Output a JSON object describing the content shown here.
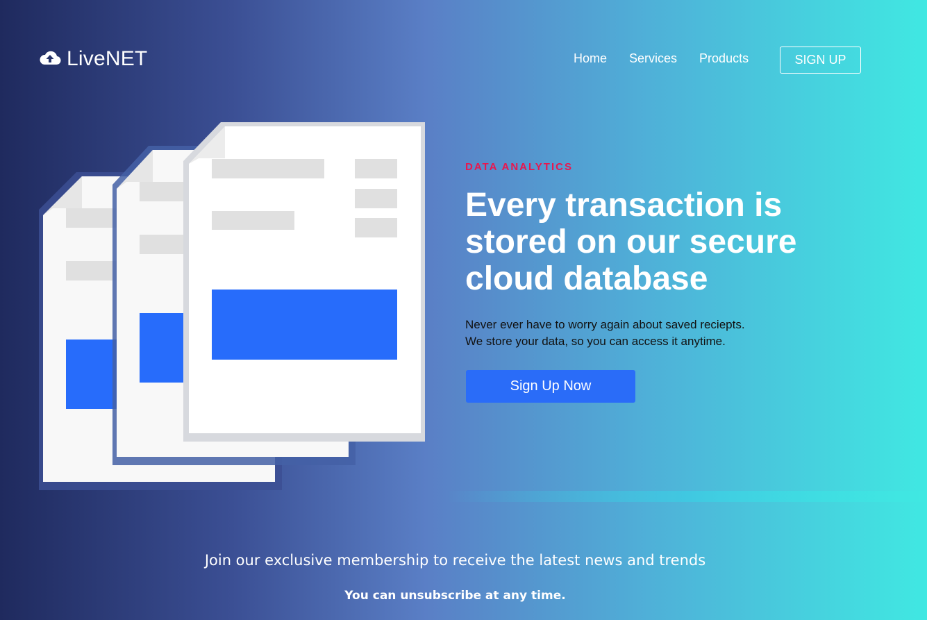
{
  "brand": {
    "name": "LiveNET",
    "icon": "cloud-upload-icon"
  },
  "nav": {
    "links": [
      "Home",
      "Services",
      "Products"
    ],
    "signup_label": "SIGN UP"
  },
  "hero": {
    "eyebrow": "DATA ANALYTICS",
    "headline_lines": [
      "Every transaction is",
      "stored on our secure",
      "cloud database"
    ],
    "description_lines": [
      "Never ever have to worry again about saved reciepts.",
      "We store your data, so you can access it anytime."
    ],
    "cta_label": "Sign Up Now",
    "illustration": "stacked-documents-illustration"
  },
  "newsletter": {
    "heading": "Join our exclusive membership to receive the latest news and trends",
    "subtext": "You can unsubscribe at any time."
  },
  "colors": {
    "accent": "#2a6cf8",
    "eyebrow": "#e8174f",
    "gradient_start": "#1f2a5e",
    "gradient_end": "#40e8e2"
  }
}
